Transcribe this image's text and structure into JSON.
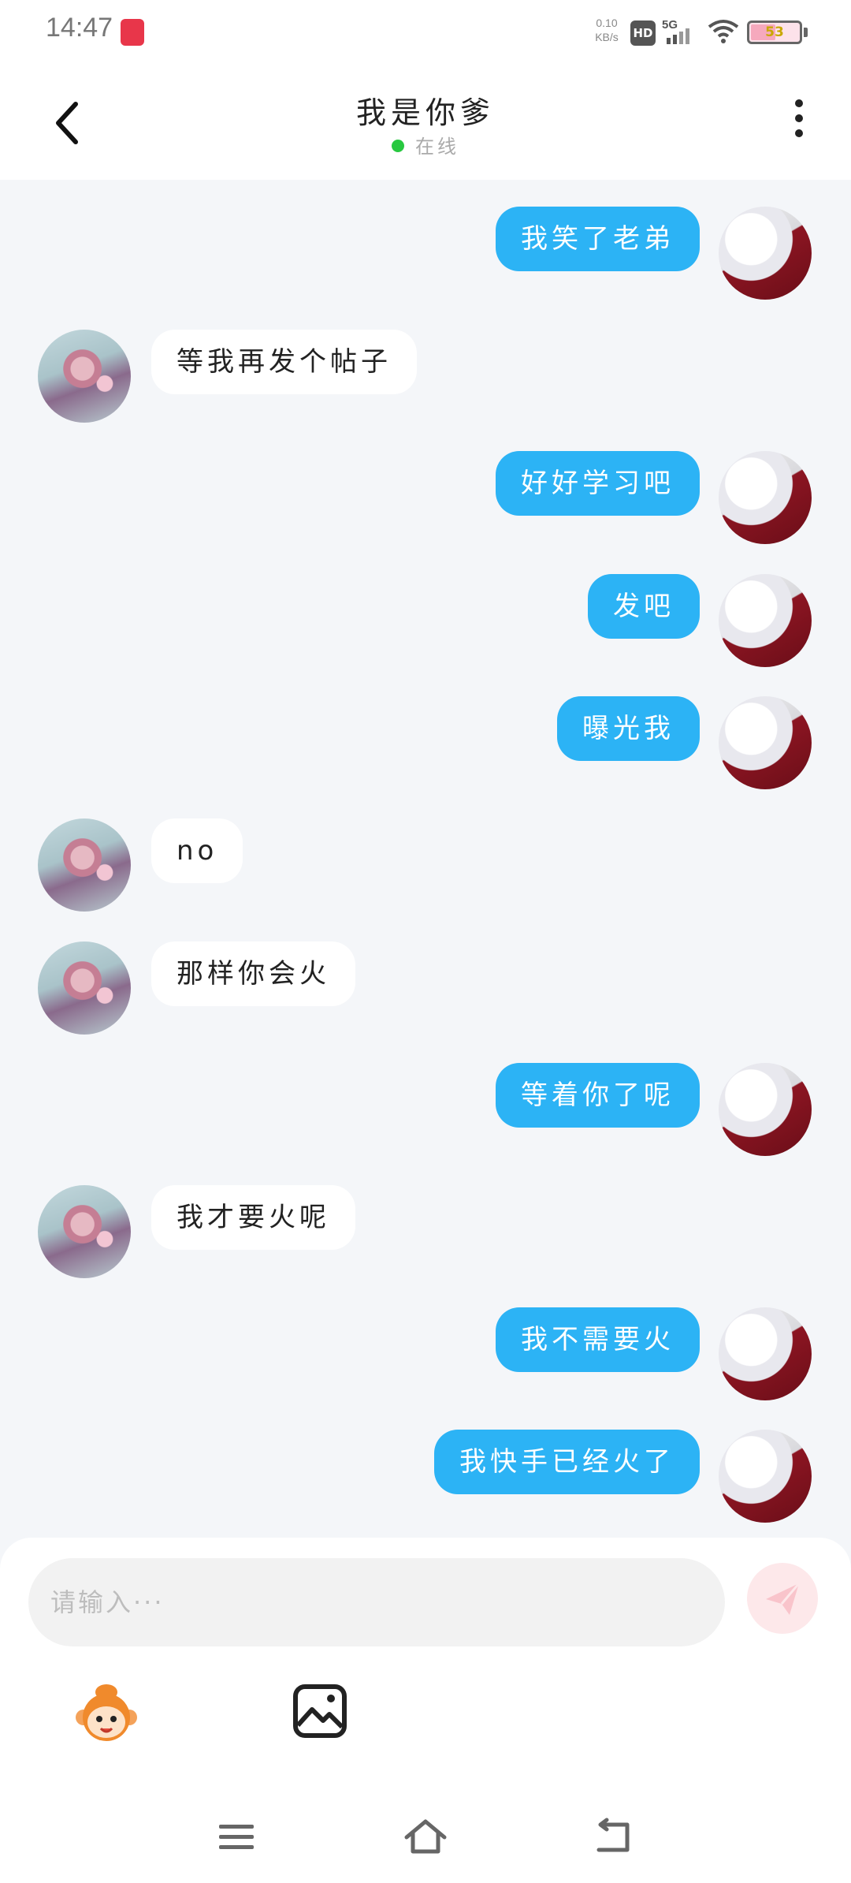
{
  "status_bar": {
    "time": "14:47",
    "net_speed_value": "0.10",
    "net_speed_unit": "KB/s",
    "hd_label": "HD",
    "network_label": "5G",
    "battery_level": "53"
  },
  "header": {
    "title": "我是你爹",
    "presence": "在线",
    "presence_color": "#28c840"
  },
  "messages": [
    {
      "side": "out",
      "text": "我笑了老弟"
    },
    {
      "side": "in",
      "text": "等我再发个帖子"
    },
    {
      "side": "out",
      "text": "好好学习吧"
    },
    {
      "side": "out",
      "text": "发吧"
    },
    {
      "side": "out",
      "text": "曝光我"
    },
    {
      "side": "in",
      "text": "no"
    },
    {
      "side": "in",
      "text": "那样你会火"
    },
    {
      "side": "out",
      "text": "等着你了呢"
    },
    {
      "side": "in",
      "text": "我才要火呢"
    },
    {
      "side": "out",
      "text": "我不需要火"
    },
    {
      "side": "out",
      "text": "我快手已经火了"
    }
  ],
  "composer": {
    "placeholder": "请输入···",
    "value": ""
  },
  "colors": {
    "outgoing_bubble": "#2cb3f5",
    "incoming_bubble": "#ffffff",
    "chat_background": "#f4f6f9"
  },
  "icons": {
    "back": "chevron-left-icon",
    "more": "more-vertical-icon",
    "send": "paper-plane-icon",
    "emoji": "monkey-emoji-icon",
    "image": "image-icon",
    "nav_menu": "menu-icon",
    "nav_home": "home-icon",
    "nav_back": "back-icon"
  }
}
